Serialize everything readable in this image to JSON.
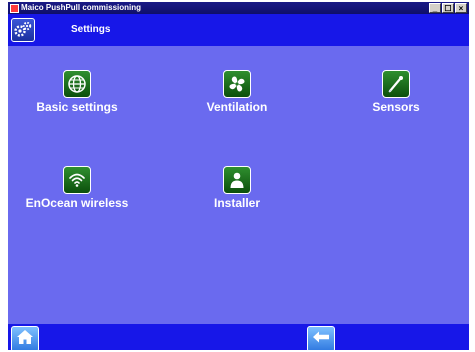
{
  "window": {
    "title": "Maico PushPull commissioning",
    "controls": [
      "_",
      "☐",
      "×"
    ]
  },
  "header": {
    "title": "Settings",
    "icon": "gears-icon"
  },
  "menu": [
    {
      "label": "Basic settings",
      "icon": "globe-icon"
    },
    {
      "label": "Ventilation",
      "icon": "fan-icon"
    },
    {
      "label": "Sensors",
      "icon": "sensor-probe-icon"
    },
    {
      "label": "EnOcean wireless",
      "icon": "wireless-signal-icon"
    },
    {
      "label": "Installer",
      "icon": "person-icon"
    }
  ],
  "footer": {
    "home_icon": "home-icon",
    "back_icon": "back-arrow-icon"
  },
  "colors": {
    "background": "#6a6aef",
    "bar": "#1717e8",
    "tile_icon": "#1f7a1f"
  }
}
